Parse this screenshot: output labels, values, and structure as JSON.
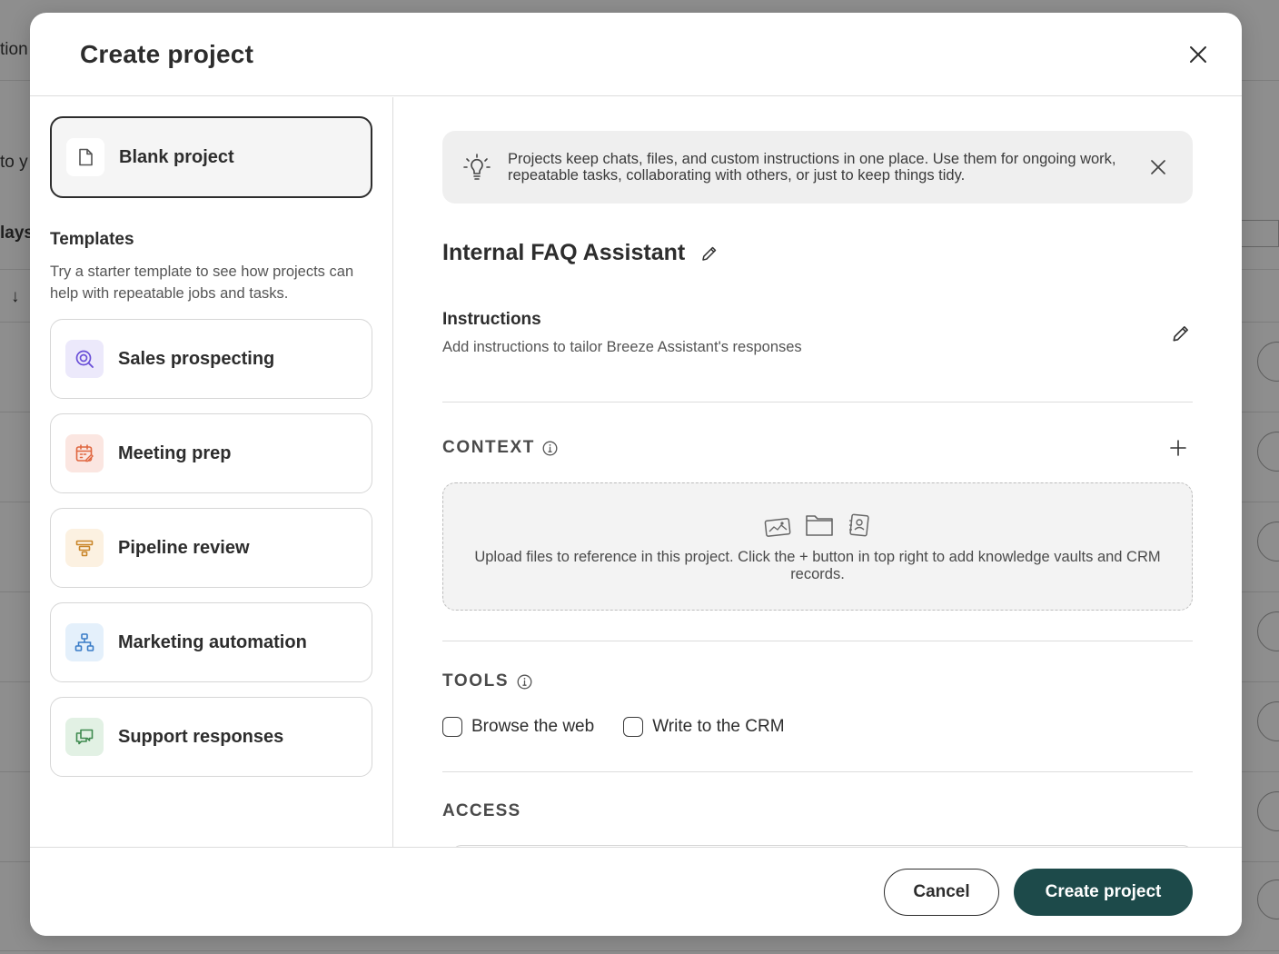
{
  "background": {
    "fragments": [
      "tion",
      "to y",
      "lays",
      "↓"
    ]
  },
  "modal": {
    "title": "Create project",
    "close_icon": "close-icon"
  },
  "left": {
    "blank_project_label": "Blank project",
    "templates_heading": "Templates",
    "templates_desc": "Try a starter template to see how projects can help with repeatable jobs and tasks.",
    "templates": [
      {
        "label": "Sales prospecting",
        "icon": "target-search-icon",
        "tile_color": "#ece9fb",
        "icon_color": "#6a4fd8"
      },
      {
        "label": "Meeting prep",
        "icon": "calendar-edit-icon",
        "tile_color": "#fbe6e1",
        "icon_color": "#e0663f"
      },
      {
        "label": "Pipeline review",
        "icon": "funnel-icon",
        "tile_color": "#fcf1e1",
        "icon_color": "#c9862a"
      },
      {
        "label": "Marketing automation",
        "icon": "org-chart-icon",
        "tile_color": "#e4f0fb",
        "icon_color": "#3a7cc7"
      },
      {
        "label": "Support responses",
        "icon": "chat-bubbles-icon",
        "tile_color": "#e2f1e4",
        "icon_color": "#3e8a4f"
      }
    ]
  },
  "right": {
    "banner_text": "Projects keep chats, files, and custom instructions in one place. Use them for ongoing work, repeatable tasks, collaborating with others, or just to keep things tidy.",
    "project_name": "Internal FAQ Assistant",
    "instructions_title": "Instructions",
    "instructions_desc": "Add instructions to tailor Breeze Assistant's responses",
    "context_title": "CONTEXT",
    "dropzone_text": "Upload files to reference in this project. Click the + button in top right to add knowledge vaults and CRM records.",
    "tools_title": "TOOLS",
    "tools": [
      {
        "label": "Browse the web",
        "checked": false
      },
      {
        "label": "Write to the CRM",
        "checked": false
      }
    ],
    "access_title": "ACCESS"
  },
  "footer": {
    "cancel_label": "Cancel",
    "create_label": "Create project"
  }
}
